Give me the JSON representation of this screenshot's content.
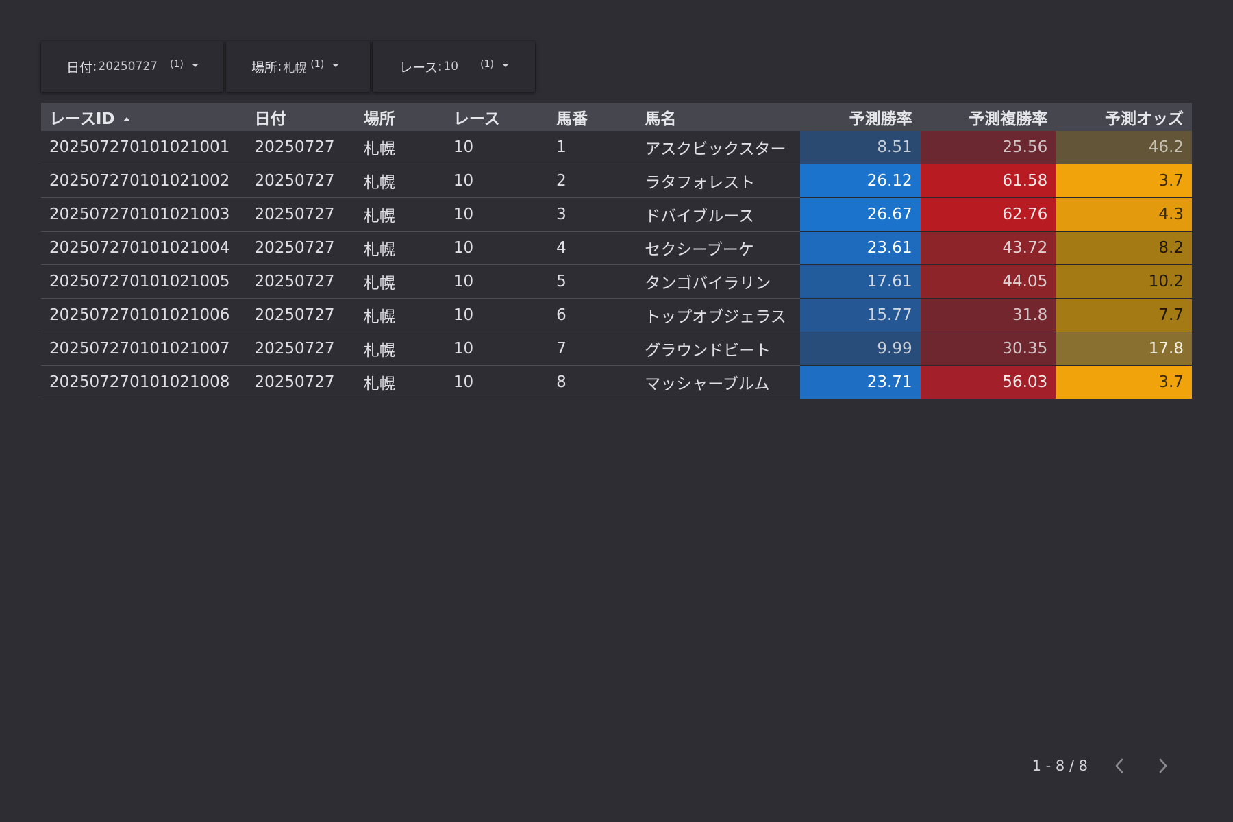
{
  "filters": [
    {
      "label": "日付",
      "value": "20250727",
      "count": "(1)"
    },
    {
      "label": "場所",
      "value": "札幌",
      "count": "(1)"
    },
    {
      "label": "レース",
      "value": "10",
      "count": "(1)"
    }
  ],
  "table": {
    "columns": [
      "レースID",
      "日付",
      "場所",
      "レース",
      "馬番",
      "馬名",
      "予測勝率",
      "予測複勝率",
      "予測オッズ"
    ],
    "sort": {
      "column": "レースID",
      "direction": "ascending"
    },
    "rows": [
      [
        "202507270101021001",
        "20250727",
        "札幌",
        "10",
        "1",
        "アスクビックスター",
        "8.51",
        "25.56",
        "46.2"
      ],
      [
        "202507270101021002",
        "20250727",
        "札幌",
        "10",
        "2",
        "ラタフォレスト",
        "26.12",
        "61.58",
        "3.7"
      ],
      [
        "202507270101021003",
        "20250727",
        "札幌",
        "10",
        "3",
        "ドバイブルース",
        "26.67",
        "62.76",
        "4.3"
      ],
      [
        "202507270101021004",
        "20250727",
        "札幌",
        "10",
        "4",
        "セクシーブーケ",
        "23.61",
        "43.72",
        "8.2"
      ],
      [
        "202507270101021005",
        "20250727",
        "札幌",
        "10",
        "5",
        "タンゴバイラリン",
        "17.61",
        "44.05",
        "10.2"
      ],
      [
        "202507270101021006",
        "20250727",
        "札幌",
        "10",
        "6",
        "トップオブジェラス",
        "15.77",
        "31.8",
        "7.7"
      ],
      [
        "202507270101021007",
        "20250727",
        "札幌",
        "10",
        "7",
        "グラウンドビート",
        "9.99",
        "30.35",
        "17.8"
      ],
      [
        "202507270101021008",
        "20250727",
        "札幌",
        "10",
        "8",
        "マッシャーブルム",
        "23.71",
        "56.03",
        "3.7"
      ]
    ],
    "cell_colors": {
      "予測勝率": [
        "#2a4a72",
        "#1c73cb",
        "#1c73cb",
        "#1e6bbd",
        "#235c9d",
        "#245794",
        "#294d7b",
        "#1e6ec3"
      ],
      "予測複勝率": [
        "#6b2830",
        "#b81c22",
        "#b81c22",
        "#8c2429",
        "#8c2429",
        "#73262e",
        "#6e272f",
        "#a3202a"
      ],
      "予測オッズ": [
        "#635638",
        "#f0a30a",
        "#e39b0d",
        "#a37a14",
        "#a37a14",
        "#a37a14",
        "#8a7030",
        "#f0a30a"
      ]
    }
  },
  "pagination": {
    "text": "1 - 8 / 8",
    "prev_icon": "chevron-left-icon",
    "next_icon": "chevron-right-icon"
  }
}
